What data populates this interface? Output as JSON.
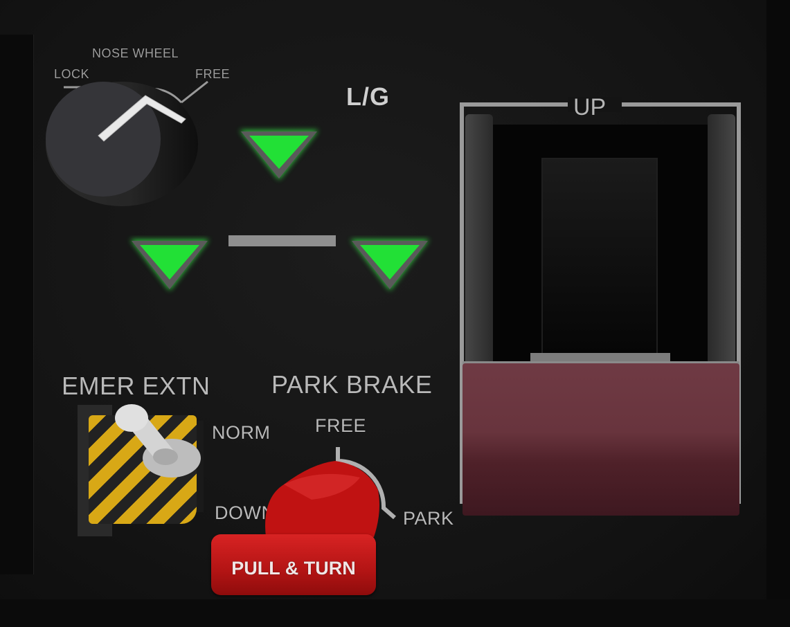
{
  "panel": {
    "nose_wheel": {
      "title": "NOSE WHEEL",
      "lock_label": "LOCK",
      "free_label": "FREE"
    },
    "landing_gear": {
      "title": "L/G",
      "indicator_color": "#25e53a",
      "lever_position_label": "UP",
      "lever_handle_color": "#6a3440"
    },
    "emer_extn": {
      "title": "EMER EXTN",
      "norm_label": "NORM",
      "down_label": "DOWN"
    },
    "park_brake": {
      "title": "PARK BRAKE",
      "free_label": "FREE",
      "park_label": "PARK",
      "knob_label": "PULL & TURN",
      "knob_color": "#c81818"
    }
  }
}
